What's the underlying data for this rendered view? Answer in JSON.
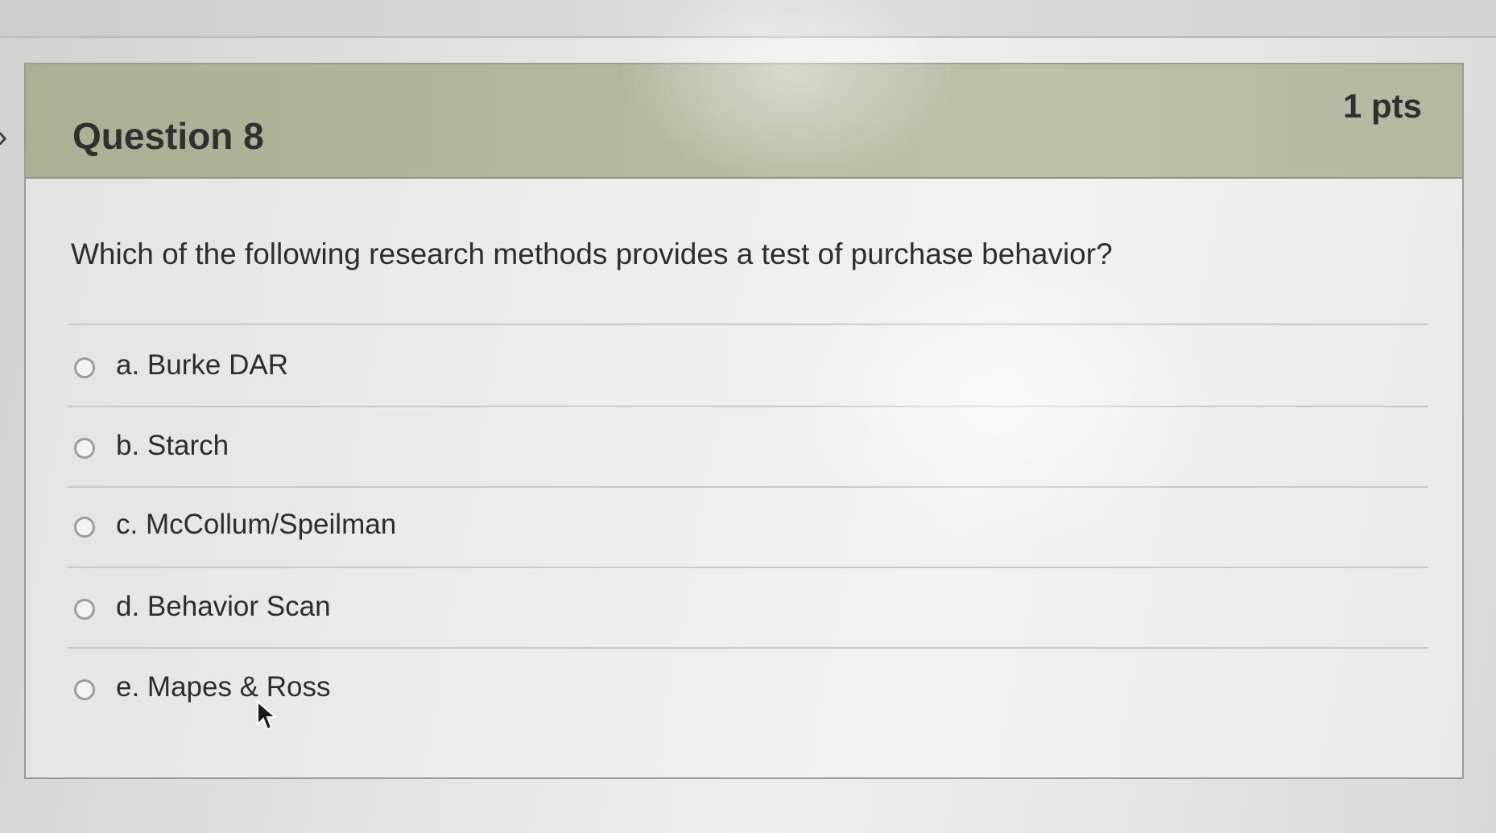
{
  "question": {
    "title": "Question 8",
    "points": "1 pts",
    "text": "Which of the following research methods provides a test of purchase behavior?",
    "answers": [
      {
        "label": "a. Burke DAR"
      },
      {
        "label": "b. Starch"
      },
      {
        "label": "c. McCollum/Speilman"
      },
      {
        "label": "d. Behavior Scan"
      },
      {
        "label": "e. Mapes & Ross"
      }
    ]
  },
  "icons": {
    "nav": "chevron-right-icon",
    "radio": "radio-unselected-icon",
    "pointer": "mouse-pointer-icon"
  },
  "colors": {
    "header_background": "#b1b89d",
    "card_border": "#9a9b97",
    "text": "#2c2e2d"
  }
}
